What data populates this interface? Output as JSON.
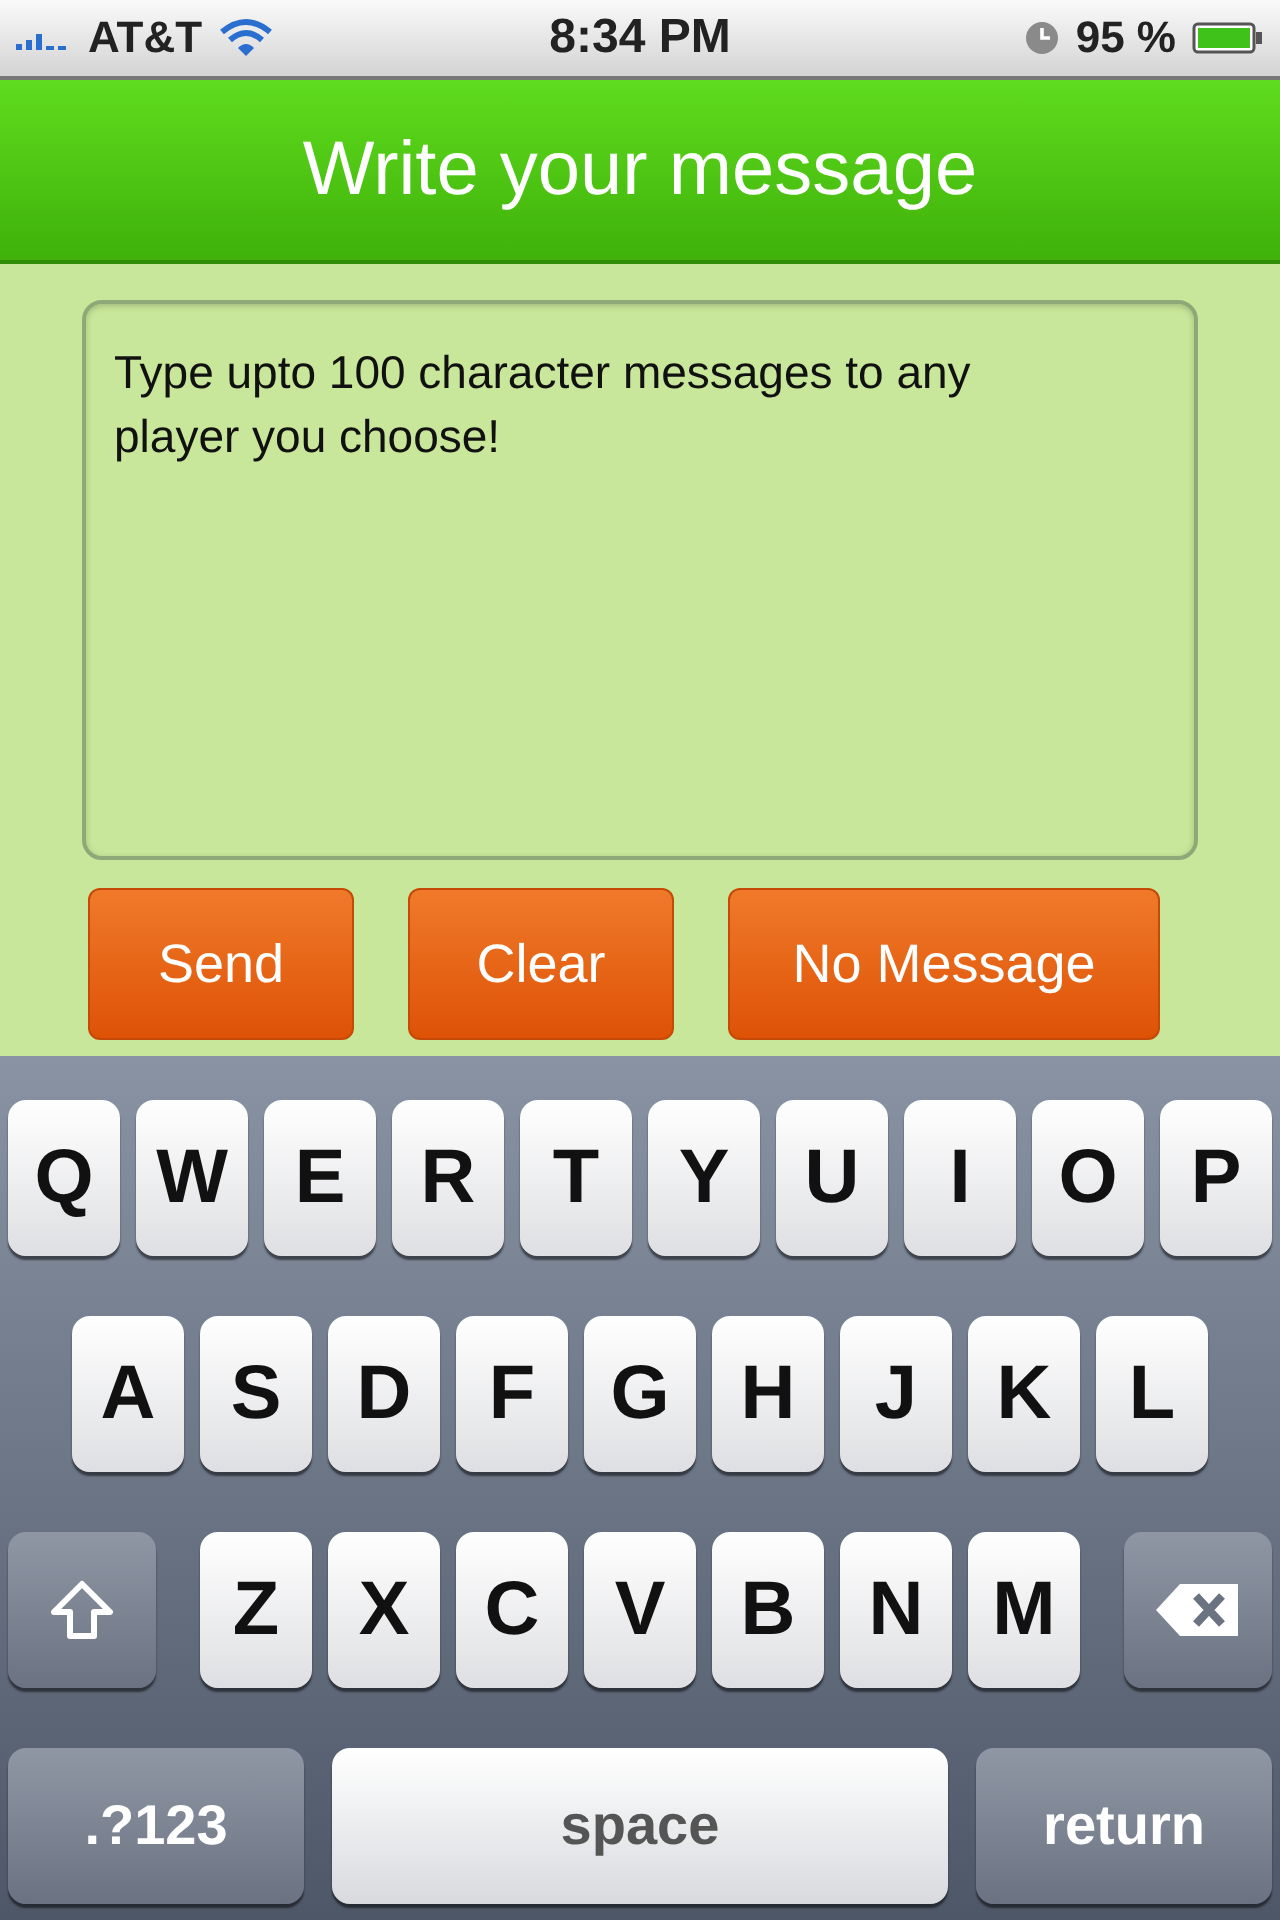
{
  "status_bar": {
    "carrier": "AT&T",
    "time": "8:34 PM",
    "battery_percent": "95 %"
  },
  "header": {
    "title": "Write your message"
  },
  "message_field": {
    "value": "Type upto 100 character messages to any player you choose!"
  },
  "buttons": [
    "Send",
    "Clear",
    "No Message"
  ],
  "keyboard": {
    "letter_rows": [
      {
        "keys": [
          "Q",
          "W",
          "E",
          "R",
          "T",
          "Y",
          "U",
          "I",
          "O",
          "P"
        ]
      },
      {
        "keys": [
          "A",
          "S",
          "D",
          "F",
          "G",
          "H",
          "J",
          "K",
          "L"
        ]
      },
      {
        "keys": [
          "Z",
          "X",
          "C",
          "V",
          "B",
          "N",
          "M"
        ]
      }
    ],
    "bottom_row": {
      "mode_key": ".?123",
      "space_key": "space",
      "return_key": "return"
    }
  }
}
